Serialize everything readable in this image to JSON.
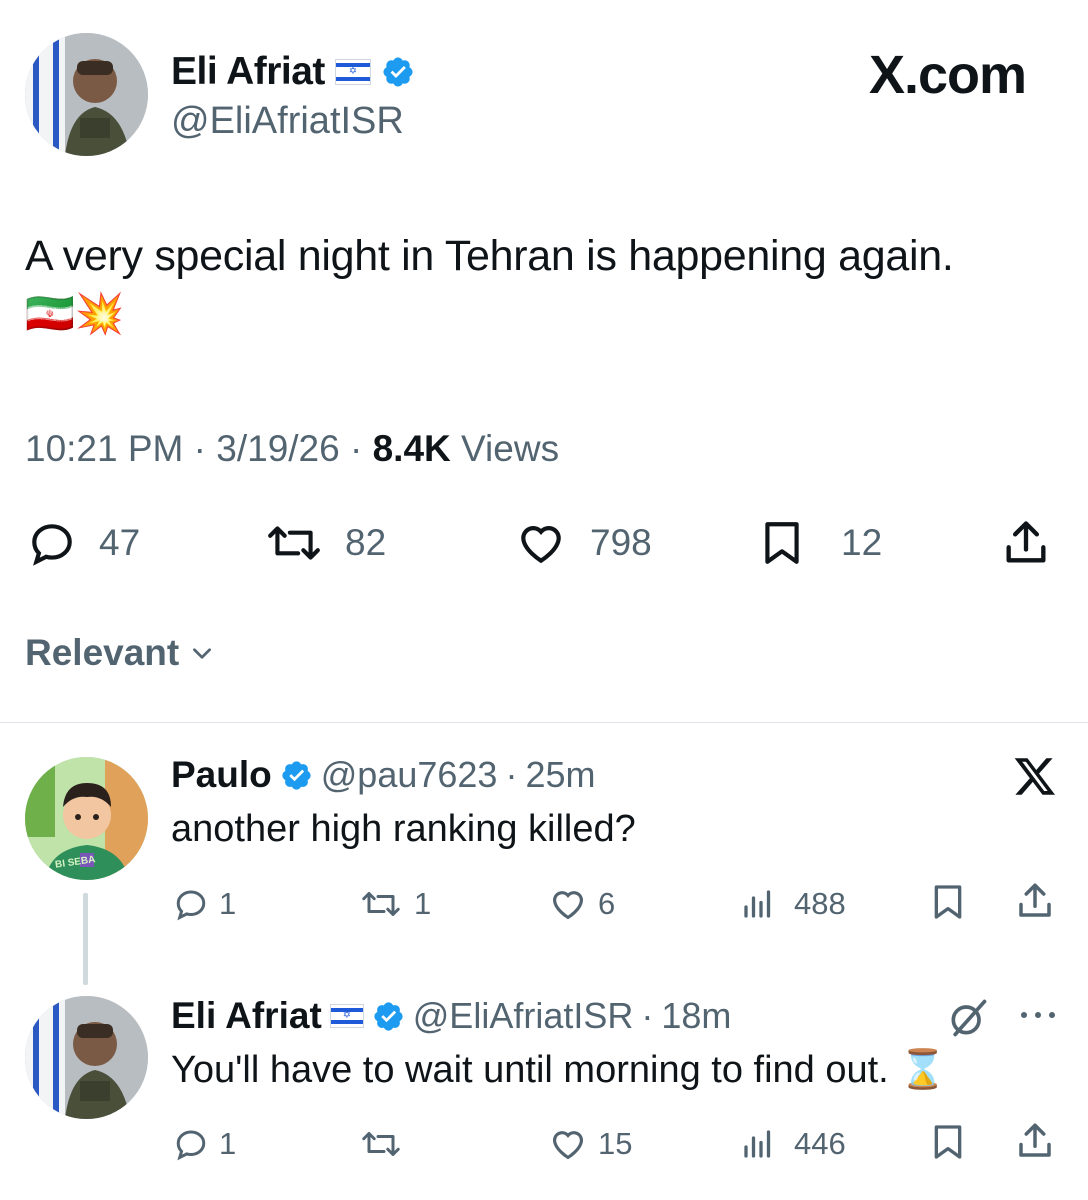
{
  "watermark": "X.com",
  "tweet": {
    "author_name": "Eli Afriat",
    "author_handle": "@EliAfriatISR",
    "text": "A very special night in Tehran is happening again.",
    "emoji": "🇮🇷💥",
    "time": "10:21 PM",
    "date": "3/19/26",
    "views_count": "8.4K",
    "views_label": "Views",
    "separator": "·",
    "actions": {
      "replies": "47",
      "reposts": "82",
      "likes": "798",
      "bookmarks": "12"
    }
  },
  "sort": {
    "label": "Relevant",
    "icon": "chevron-down-icon"
  },
  "replies": [
    {
      "name": "Paulo",
      "handle": "@pau7623",
      "separator": "·",
      "age": "25m",
      "text": "another high ranking killed?",
      "avatar_label": "BI SEBA",
      "corner_icon": "x-logo-icon",
      "actions": {
        "replies": "1",
        "reposts": "1",
        "likes": "6",
        "views": "488"
      }
    },
    {
      "name": "Eli Afriat",
      "handle": "@EliAfriatISR",
      "separator": "·",
      "age": "18m",
      "text": "You'll have to wait until morning to find out.",
      "emoji": "⌛",
      "corner_icon": "grok-icon",
      "more_icon": "more-icon",
      "actions": {
        "replies": "1",
        "reposts": "",
        "likes": "15",
        "views": "446"
      }
    }
  ],
  "colors": {
    "text": "#0f1419",
    "muted": "#536471",
    "verified": "#1d9bf0",
    "divider": "#dfe3e7"
  }
}
